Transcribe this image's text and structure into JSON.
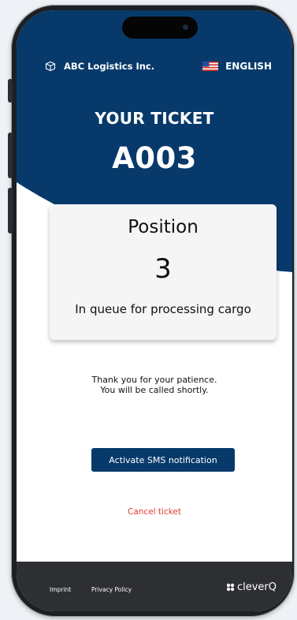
{
  "header": {
    "company_name": "ABC Logistics Inc.",
    "company_icon": "box-icon",
    "language_label": "ENGLISH",
    "language_icon": "us-flag-icon"
  },
  "ticket": {
    "label": "YOUR TICKET",
    "number": "A003"
  },
  "queue_card": {
    "position_label": "Position",
    "position_value": "3",
    "queue_description": "In queue for processing cargo"
  },
  "message": {
    "line1": "Thank you for your patience.",
    "line2": "You will be called shortly."
  },
  "actions": {
    "sms_button_label": "Activate SMS notification",
    "cancel_label": "Cancel ticket"
  },
  "footer": {
    "imprint_label": "Imprint",
    "privacy_label": "Privacy Policy",
    "brand_name": "cleverQ",
    "brand_icon": "cleverq-logo-icon"
  },
  "colors": {
    "primary": "#073a6b",
    "cancel": "#e53935",
    "footer_bg": "#2d2f33"
  }
}
